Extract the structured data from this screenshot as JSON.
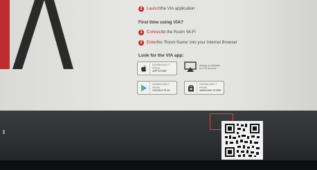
{
  "steps": {
    "launch": {
      "num": "2",
      "highlight": "Launch",
      "rest": " the VIA application"
    },
    "first_time_heading": "First time using VIA?",
    "connect": {
      "num": "1",
      "highlight": "Connect",
      "rest": " to the Room Wi-Fi"
    },
    "enter": {
      "num": "2",
      "highlight": "Enter",
      "rest": " the 'Room Name' into your Internet Browser"
    }
  },
  "app_heading": "Look for the VIA app:",
  "badges": {
    "app_store": {
      "small": "Download it from",
      "name": "APP STORE"
    },
    "airplay": {
      "line1": "Airplay is available",
      "line2": "for iOS devices"
    },
    "google_play": {
      "small": "Download it from",
      "name": "GOOGLE PLAY"
    },
    "windows_store": {
      "small": "Download it from",
      "name": "WINDOWS STORE"
    }
  },
  "colors": {
    "accent": "#c0272d",
    "upper_bg": "#e3e3e0",
    "lower_bg": "#2d2e30"
  },
  "icons": [
    "apple-icon",
    "airplay-icon",
    "google-play-icon",
    "windows-store-icon",
    "qr-code"
  ]
}
